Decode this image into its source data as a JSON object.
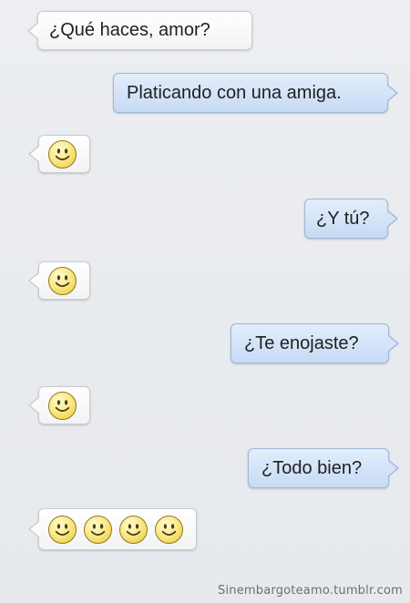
{
  "messages": [
    {
      "sender": "other",
      "type": "text",
      "text": "¿Qué haces, amor?"
    },
    {
      "sender": "me",
      "type": "text",
      "text": "Platicando con una amiga."
    },
    {
      "sender": "other",
      "type": "emoji",
      "icons": [
        "smiley-icon"
      ]
    },
    {
      "sender": "me",
      "type": "text",
      "text": "¿Y tú?"
    },
    {
      "sender": "other",
      "type": "emoji",
      "icons": [
        "smiley-icon"
      ]
    },
    {
      "sender": "me",
      "type": "text",
      "text": "¿Te enojaste?"
    },
    {
      "sender": "other",
      "type": "emoji",
      "icons": [
        "smiley-icon"
      ]
    },
    {
      "sender": "me",
      "type": "text",
      "text": "¿Todo bien?"
    },
    {
      "sender": "other",
      "type": "emoji",
      "icons": [
        "smiley-icon",
        "smiley-icon",
        "smiley-icon",
        "smiley-icon"
      ]
    }
  ],
  "credit": "Sinembargoteamo.tumblr.com",
  "colors": {
    "incoming_bg": "#ffffff",
    "outgoing_bg": "#d2e2f7",
    "outgoing_border": "#9db7d9",
    "background": "#e9ecef",
    "smiley_fill": "#fbe98a"
  }
}
